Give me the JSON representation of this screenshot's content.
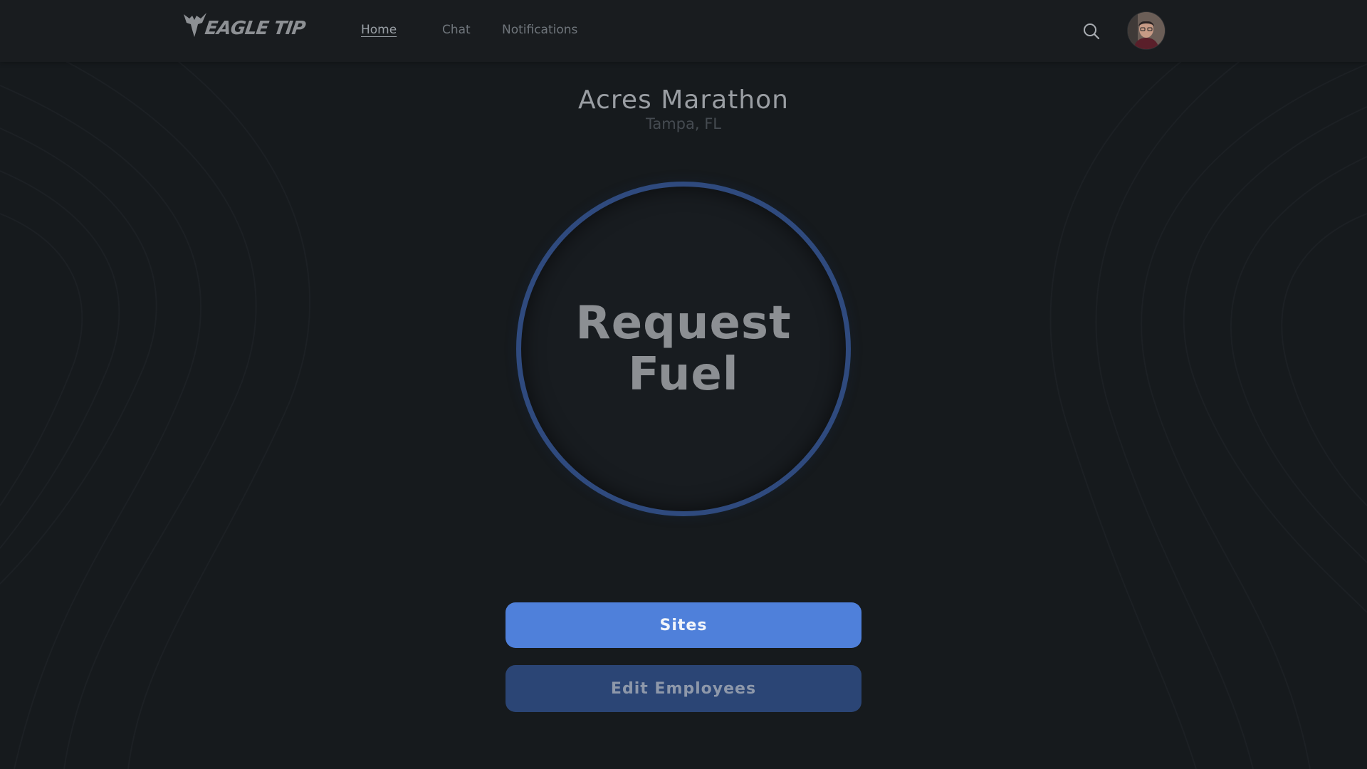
{
  "app": {
    "brand": "EAGLE TIP"
  },
  "nav": {
    "items": [
      {
        "label": "Home",
        "active": true
      },
      {
        "label": "Chat",
        "active": false
      },
      {
        "label": "Notifications",
        "active": false
      }
    ]
  },
  "header": {
    "search_icon": "search-icon",
    "avatar_icon": "user-avatar"
  },
  "site": {
    "name": "Acres Marathon",
    "location": "Tampa, FL"
  },
  "main": {
    "request_fuel_label": "Request Fuel",
    "sites_label": "Sites",
    "edit_employees_label": "Edit Employees"
  },
  "colors": {
    "background": "#161a1d",
    "ring": "#2f4a7e",
    "primary_button": "#4f80da",
    "secondary_button": "#2b4575"
  }
}
